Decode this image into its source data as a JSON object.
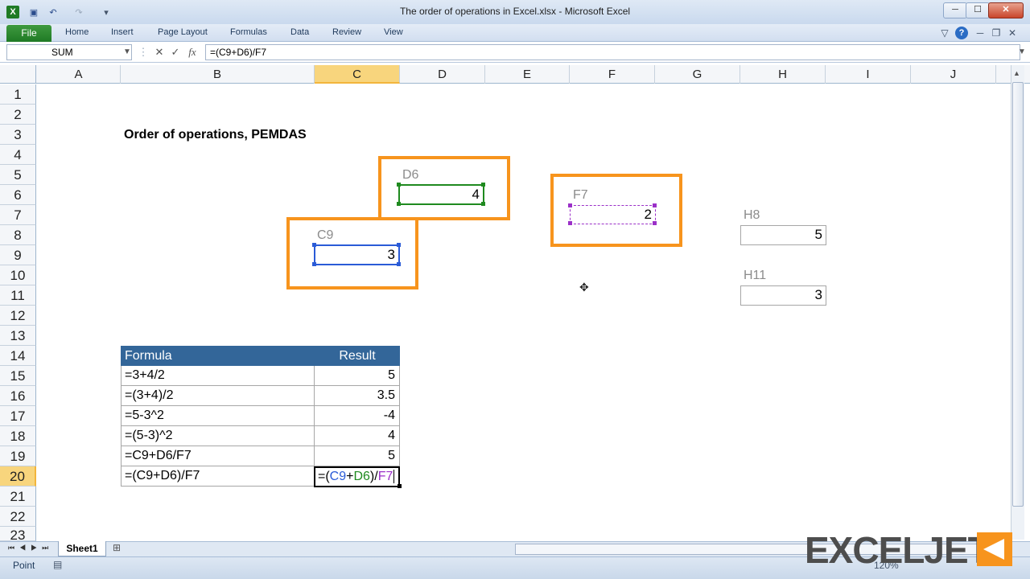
{
  "window": {
    "title": "The order of operations in Excel.xlsx  -  Microsoft Excel",
    "min_label": "─",
    "max_label": "☐",
    "close_label": "✕"
  },
  "ribbon": {
    "file_tab": "File",
    "tabs": [
      "Home",
      "Insert",
      "Page Layout",
      "Formulas",
      "Data",
      "Review",
      "View"
    ]
  },
  "formula_bar": {
    "name_box": "SUM",
    "formula": "=(C9+D6)/F7",
    "cancel_symbol": "✕",
    "enter_symbol": "✓",
    "fx_symbol": "fx"
  },
  "grid": {
    "columns": [
      "A",
      "B",
      "C",
      "D",
      "E",
      "F",
      "G",
      "H",
      "I",
      "J"
    ],
    "rows": [
      "1",
      "2",
      "3",
      "4",
      "5",
      "6",
      "7",
      "8",
      "9",
      "10",
      "11",
      "12",
      "13",
      "14",
      "15",
      "16",
      "17",
      "18",
      "19",
      "20",
      "21",
      "22",
      "23"
    ],
    "selected_column": "C",
    "selected_row": "20"
  },
  "heading": "Order of operations, PEMDAS",
  "inputs": {
    "d6": {
      "label": "D6",
      "value": "4"
    },
    "f7": {
      "label": "F7",
      "value": "2"
    },
    "c9": {
      "label": "C9",
      "value": "3"
    },
    "h8": {
      "label": "H8",
      "value": "5"
    },
    "h11": {
      "label": "H11",
      "value": "3"
    }
  },
  "table": {
    "headers": [
      "Formula",
      "Result"
    ],
    "rows": [
      {
        "formula": "=3+4/2",
        "result": "5"
      },
      {
        "formula": "=(3+4)/2",
        "result": "3.5"
      },
      {
        "formula": "=5-3^2",
        "result": "-4"
      },
      {
        "formula": "=(5-3)^2",
        "result": "4"
      },
      {
        "formula": "=C9+D6/F7",
        "result": "5"
      },
      {
        "formula": "=(C9+D6)/F7",
        "result": ""
      }
    ]
  },
  "editing_cell": {
    "parts": [
      {
        "text": "=(",
        "color": "#000000"
      },
      {
        "text": "C9",
        "color": "#2a5bd7"
      },
      {
        "text": "+",
        "color": "#000000"
      },
      {
        "text": "D6",
        "color": "#1f8a1f"
      },
      {
        "text": ")/",
        "color": "#000000"
      },
      {
        "text": "F7",
        "color": "#9b30c8"
      }
    ]
  },
  "colors": {
    "orange_frame": "#f7941d",
    "table_header": "#336699",
    "c9_ref": "#2a5bd7",
    "d6_ref": "#1f8a1f",
    "f7_ref": "#9b30c8"
  },
  "sheet_tabs": {
    "active": "Sheet1"
  },
  "status": {
    "mode": "Point",
    "zoom": "120%"
  },
  "watermark": {
    "text": "EXCELJET"
  }
}
